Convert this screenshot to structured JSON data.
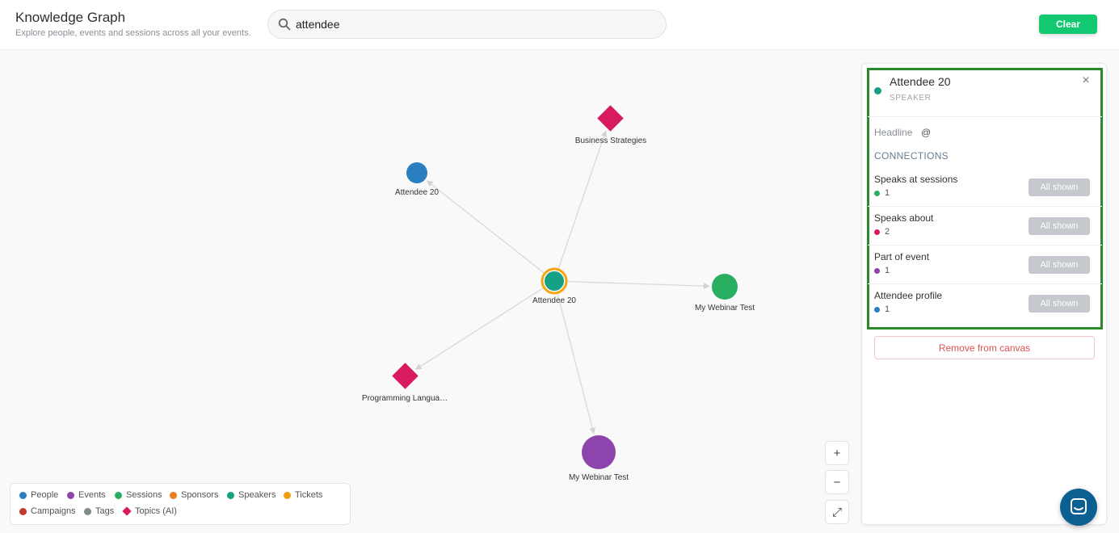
{
  "header": {
    "title": "Knowledge Graph",
    "subtitle": "Explore people, events and sessions across all your events.",
    "search_value": "attendee",
    "clear_label": "Clear"
  },
  "colors": {
    "people": "#2a7fc0",
    "events": "#8e44ad",
    "sessions": "#27ae60",
    "sponsors": "#e67e22",
    "speakers": "#16a085",
    "tickets": "#f39c12",
    "campaigns": "#c0392b",
    "tags": "#7f8c8d",
    "topics": "#d81b60",
    "accent": "#12c971",
    "highlight": "#2a8a2a"
  },
  "graph": {
    "nodes": [
      {
        "id": "center",
        "label": "Attendee 20",
        "kind": "speaker",
        "selected": true
      },
      {
        "id": "business",
        "label": "Business Strategies",
        "kind": "topic"
      },
      {
        "id": "attendee-profile",
        "label": "Attendee 20",
        "kind": "person"
      },
      {
        "id": "webinar-session",
        "label": "My Webinar Test",
        "kind": "session"
      },
      {
        "id": "programming",
        "label": "Programming Langua…",
        "kind": "topic"
      },
      {
        "id": "webinar-event",
        "label": "My Webinar Test",
        "kind": "event"
      }
    ],
    "edges": [
      {
        "from": "center",
        "to": "business"
      },
      {
        "from": "center",
        "to": "attendee-profile"
      },
      {
        "from": "center",
        "to": "webinar-session"
      },
      {
        "from": "center",
        "to": "programming"
      },
      {
        "from": "center",
        "to": "webinar-event"
      }
    ]
  },
  "legend": {
    "items": [
      {
        "label": "People",
        "color": "#2a7fc0",
        "shape": "dot"
      },
      {
        "label": "Events",
        "color": "#8e44ad",
        "shape": "dot"
      },
      {
        "label": "Sessions",
        "color": "#27ae60",
        "shape": "dot"
      },
      {
        "label": "Sponsors",
        "color": "#e67e22",
        "shape": "dot"
      },
      {
        "label": "Speakers",
        "color": "#16a085",
        "shape": "dot"
      },
      {
        "label": "Tickets",
        "color": "#f39c12",
        "shape": "dot"
      },
      {
        "label": "Campaigns",
        "color": "#c0392b",
        "shape": "dot"
      },
      {
        "label": "Tags",
        "color": "#7f8c8d",
        "shape": "dot"
      },
      {
        "label": "Topics (AI)",
        "color": "#d81b60",
        "shape": "diamond"
      }
    ]
  },
  "zoom": {
    "in_label": "+",
    "out_label": "−",
    "fit_label": "⤢"
  },
  "panel": {
    "name": "Attendee 20",
    "type": "SPEAKER",
    "headline_label": "Headline",
    "headline_value": "@",
    "connections_title": "CONNECTIONS",
    "connections": [
      {
        "name": "Speaks at sessions",
        "count": "1",
        "color": "#27ae60",
        "button": "All shown"
      },
      {
        "name": "Speaks about",
        "count": "2",
        "color": "#d81b60",
        "button": "All shown"
      },
      {
        "name": "Part of event",
        "count": "1",
        "color": "#8e44ad",
        "button": "All shown"
      },
      {
        "name": "Attendee profile",
        "count": "1",
        "color": "#2a7fc0",
        "button": "All shown"
      }
    ],
    "remove_label": "Remove from canvas",
    "close_label": "×"
  }
}
